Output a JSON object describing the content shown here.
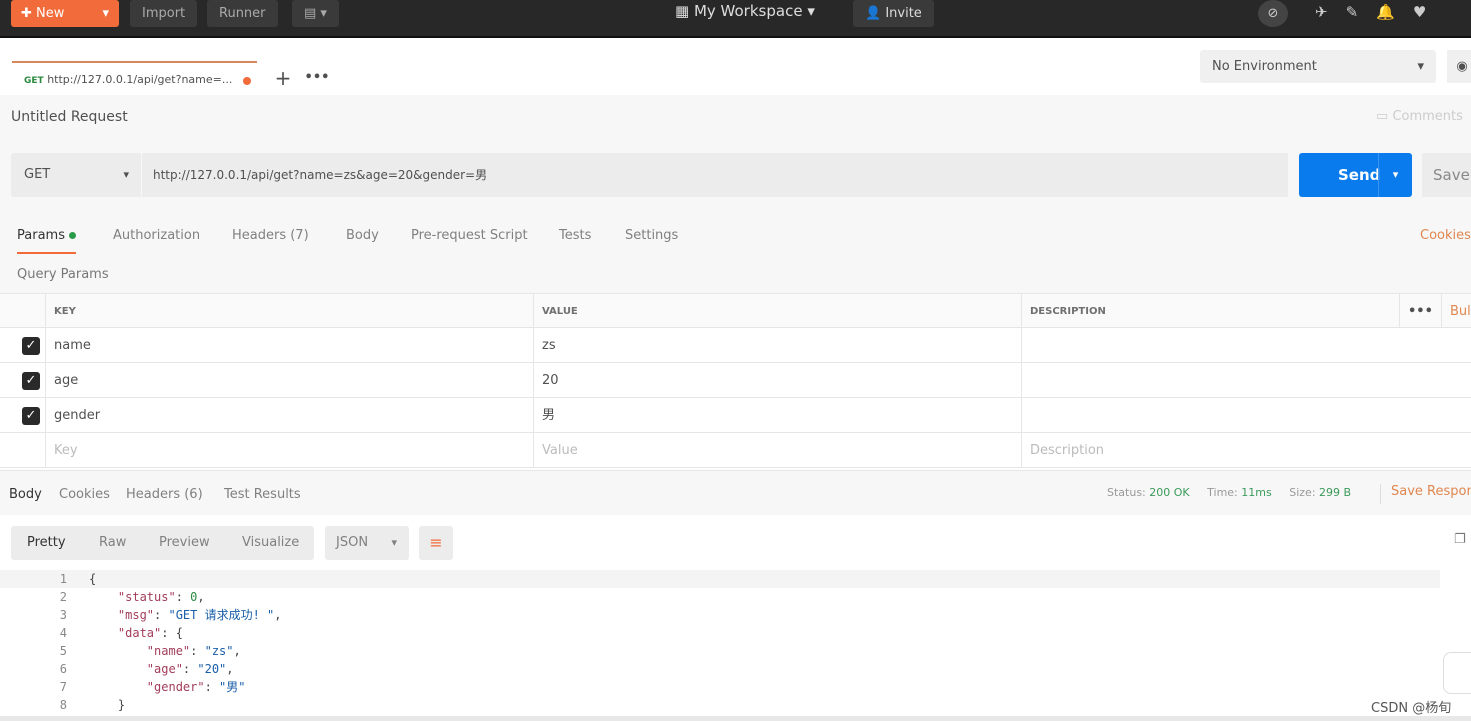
{
  "topbar": {
    "new": "New",
    "import": "Import",
    "runner": "Runner",
    "workspace": "My Workspace",
    "invite": "Invite"
  },
  "tab": {
    "method": "GET",
    "url": "http://127.0.0.1/api/get?name=..."
  },
  "environment": "No Environment",
  "request": {
    "title": "Untitled Request",
    "comments": "Comments",
    "method": "GET",
    "url": "http://127.0.0.1/api/get?name=zs&age=20&gender=男",
    "send": "Send",
    "save": "Save"
  },
  "req_tabs": [
    "Params",
    "Authorization",
    "Headers (7)",
    "Body",
    "Pre-request Script",
    "Tests",
    "Settings"
  ],
  "cookies": "Cookies",
  "query_params": {
    "title": "Query Params",
    "headers": [
      "KEY",
      "VALUE",
      "DESCRIPTION"
    ],
    "bulk": "Bul",
    "rows": [
      {
        "key": "name",
        "value": "zs",
        "checked": true
      },
      {
        "key": "age",
        "value": "20",
        "checked": true
      },
      {
        "key": "gender",
        "value": "男",
        "checked": true
      }
    ],
    "placeholders": {
      "key": "Key",
      "value": "Value",
      "description": "Description"
    }
  },
  "response": {
    "tabs": [
      "Body",
      "Cookies",
      "Headers (6)",
      "Test Results"
    ],
    "status_label": "Status:",
    "status": "200 OK",
    "time_label": "Time:",
    "time": "11ms",
    "size_label": "Size:",
    "size": "299 B",
    "save": "Save Respon",
    "views": [
      "Pretty",
      "Raw",
      "Preview",
      "Visualize"
    ],
    "format": "JSON",
    "lines": [
      [
        [
          "{",
          "p"
        ]
      ],
      [
        [
          "    ",
          "p"
        ],
        [
          "\"status\"",
          "k"
        ],
        [
          ": ",
          "p"
        ],
        [
          "0",
          "n"
        ],
        [
          ",",
          "p"
        ]
      ],
      [
        [
          "    ",
          "p"
        ],
        [
          "\"msg\"",
          "k"
        ],
        [
          ": ",
          "p"
        ],
        [
          "\"GET 请求成功! \"",
          "s"
        ],
        [
          ",",
          "p"
        ]
      ],
      [
        [
          "    ",
          "p"
        ],
        [
          "\"data\"",
          "k"
        ],
        [
          ": {",
          "p"
        ]
      ],
      [
        [
          "        ",
          "p"
        ],
        [
          "\"name\"",
          "k"
        ],
        [
          ": ",
          "p"
        ],
        [
          "\"zs\"",
          "s"
        ],
        [
          ",",
          "p"
        ]
      ],
      [
        [
          "        ",
          "p"
        ],
        [
          "\"age\"",
          "k"
        ],
        [
          ": ",
          "p"
        ],
        [
          "\"20\"",
          "s"
        ],
        [
          ",",
          "p"
        ]
      ],
      [
        [
          "        ",
          "p"
        ],
        [
          "\"gender\"",
          "k"
        ],
        [
          ": ",
          "p"
        ],
        [
          "\"男\"",
          "s"
        ]
      ],
      [
        [
          "    ",
          "p"
        ],
        [
          "}",
          "p"
        ]
      ]
    ]
  },
  "watermark": "CSDN @杨旬",
  "colors": {
    "accent": "#f26b3a",
    "send": "#097bed",
    "status_green": "#3a9a5a"
  }
}
